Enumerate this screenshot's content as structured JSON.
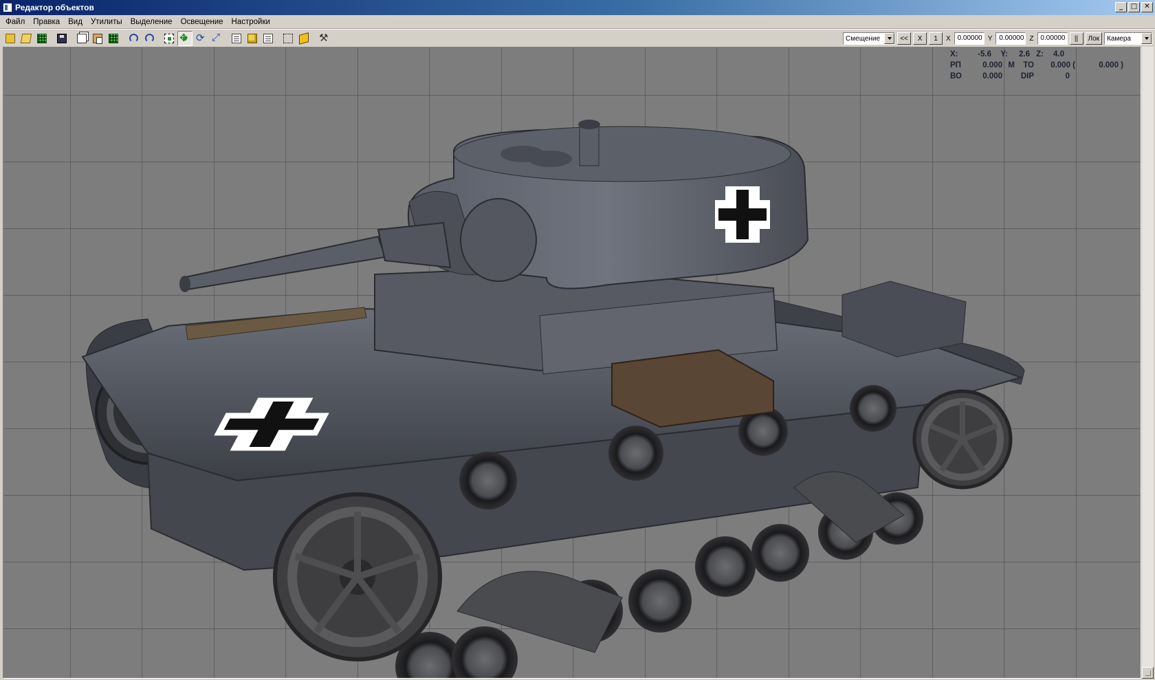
{
  "window": {
    "title": "Редактор объектов"
  },
  "menu": [
    "Файл",
    "Правка",
    "Вид",
    "Утилиты",
    "Выделение",
    "Освещение",
    "Настройки"
  ],
  "toolbar": {
    "icons": [
      "open-icon",
      "open-folder-icon",
      "grid-icon",
      "save-icon",
      "copy-icon",
      "paste-icon",
      "grid-green-icon",
      "undo-icon",
      "redo-icon",
      "select-icon",
      "move-icon",
      "rotate-icon",
      "scale-icon",
      "box-icon",
      "box-yellow-icon",
      "doc-icon",
      "dotted-select-icon",
      "cube-icon",
      "tools-icon"
    ],
    "mode_combo": "Смещение",
    "back_btn": "<<",
    "x_btn": "X",
    "one_btn": "1",
    "x_label": "X",
    "x_value": "0.00000",
    "y_label": "Y",
    "y_value": "0.00000",
    "z_label": "Z",
    "z_value": "0.00000",
    "pause_btn": "||",
    "lok_btn": "Лок",
    "camera_combo": "Камера"
  },
  "overlay": {
    "row1": {
      "x_lbl": "X:",
      "x_val": "-5.6",
      "y_lbl": "Y:",
      "y_val": "2.6",
      "z_lbl": "Z:",
      "z_val": "4.0"
    },
    "row2": {
      "rp_lbl": "РП",
      "rp_val": "0.000",
      "m_lbl": "М",
      "to_lbl": "ТО",
      "to_val": "0.000 (",
      "to_val2": "0.000 )"
    },
    "row3": {
      "vo_lbl": "ВО",
      "vo_val": "0.000",
      "dip_lbl": "DIP",
      "dip_val": "0"
    }
  },
  "colors": {
    "viewport_bg": "#7d7d7d",
    "grid": "#4a4a4a",
    "tank_body": "#4a4d55",
    "titlebar": "#0a246a"
  }
}
